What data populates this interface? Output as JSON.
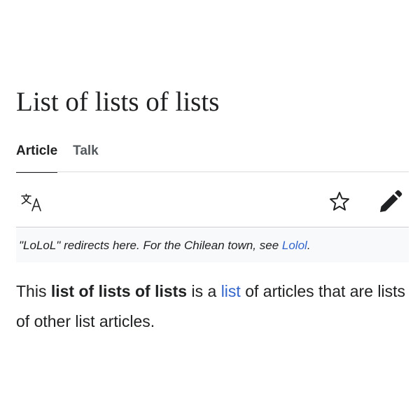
{
  "page": {
    "title": "List of lists of lists"
  },
  "tabs": [
    {
      "label": "Article",
      "active": true
    },
    {
      "label": "Talk",
      "active": false
    }
  ],
  "toolbar": {
    "icons": [
      "translate-icon",
      "star-icon",
      "pencil-icon"
    ]
  },
  "hatnote": {
    "prefix": "\"LoLoL\" redirects here. For the Chilean town, see ",
    "link": "Lolol",
    "suffix": "."
  },
  "lead": {
    "part1": "This ",
    "bold": "list of lists of lists",
    "part2": " is a ",
    "link": "list",
    "part3": " of articles that are lists of other list articles."
  },
  "colors": {
    "text": "#202122",
    "link": "#3366cc",
    "hatnote_bg": "#f8f9fa",
    "divider": "#c8ccd1"
  }
}
